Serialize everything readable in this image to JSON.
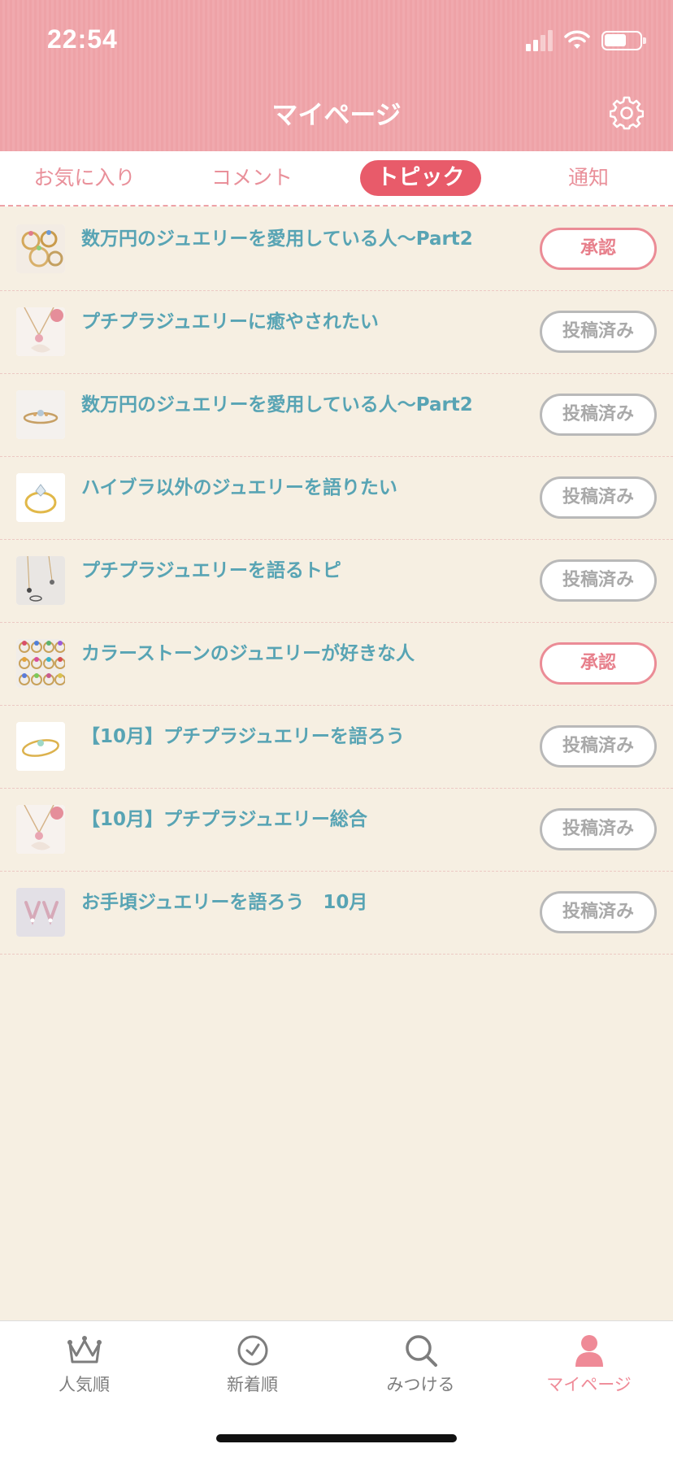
{
  "status_bar": {
    "time": "22:54"
  },
  "header": {
    "title": "マイページ",
    "settings_icon": "gear-icon"
  },
  "tabs": [
    {
      "label": "お気に入り",
      "active": false
    },
    {
      "label": "コメント",
      "active": false
    },
    {
      "label": "トピック",
      "active": true
    },
    {
      "label": "通知",
      "active": false
    }
  ],
  "topics": [
    {
      "title": "数万円のジュエリーを愛用している人〜Part2",
      "status": "承認",
      "status_type": "approve"
    },
    {
      "title": "プチプラジュエリーに癒やされたい",
      "status": "投稿済み",
      "status_type": "posted"
    },
    {
      "title": "数万円のジュエリーを愛用している人〜Part2",
      "status": "投稿済み",
      "status_type": "posted"
    },
    {
      "title": "ハイブラ以外のジュエリーを語りたい",
      "status": "投稿済み",
      "status_type": "posted"
    },
    {
      "title": "プチプラジュエリーを語るトピ",
      "status": "投稿済み",
      "status_type": "posted"
    },
    {
      "title": "カラーストーンのジュエリーが好きな人",
      "status": "承認",
      "status_type": "approve"
    },
    {
      "title": "【10月】プチプラジュエリーを語ろう",
      "status": "投稿済み",
      "status_type": "posted"
    },
    {
      "title": "【10月】プチプラジュエリー総合",
      "status": "投稿済み",
      "status_type": "posted"
    },
    {
      "title": "お手頃ジュエリーを語ろう　10月",
      "status": "投稿済み",
      "status_type": "posted"
    }
  ],
  "bottom_nav": [
    {
      "label": "人気順",
      "icon": "crown-icon",
      "active": false
    },
    {
      "label": "新着順",
      "icon": "clock-icon",
      "active": false
    },
    {
      "label": "みつける",
      "icon": "search-icon",
      "active": false
    },
    {
      "label": "マイページ",
      "icon": "person-icon",
      "active": true
    }
  ],
  "colors": {
    "header_pink": "#eea2a7",
    "accent_red": "#e85b6a",
    "title_teal": "#58a4b4",
    "background_beige": "#f6efe2"
  }
}
